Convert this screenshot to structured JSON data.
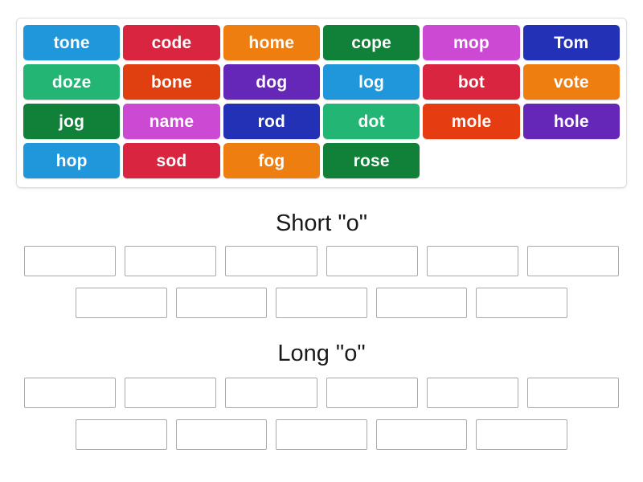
{
  "word_bank": {
    "tiles": [
      {
        "label": "tone",
        "color": "#1f97da"
      },
      {
        "label": "code",
        "color": "#d9253f"
      },
      {
        "label": "home",
        "color": "#ef7e10"
      },
      {
        "label": "cope",
        "color": "#118039"
      },
      {
        "label": "mop",
        "color": "#cc49d4"
      },
      {
        "label": "Tom",
        "color": "#2231b5"
      },
      {
        "label": "doze",
        "color": "#22b573"
      },
      {
        "label": "bone",
        "color": "#e0400f"
      },
      {
        "label": "dog",
        "color": "#6527b8"
      },
      {
        "label": "log",
        "color": "#1f97da"
      },
      {
        "label": "bot",
        "color": "#d9253f"
      },
      {
        "label": "vote",
        "color": "#ef7e10"
      },
      {
        "label": "jog",
        "color": "#118039"
      },
      {
        "label": "name",
        "color": "#cc49d4"
      },
      {
        "label": "rod",
        "color": "#2231b5"
      },
      {
        "label": "dot",
        "color": "#22b573"
      },
      {
        "label": "mole",
        "color": "#e63c12"
      },
      {
        "label": "hole",
        "color": "#6527b8"
      },
      {
        "label": "hop",
        "color": "#1f97da"
      },
      {
        "label": "sod",
        "color": "#d9253f"
      },
      {
        "label": "fog",
        "color": "#ef7e10"
      },
      {
        "label": "rose",
        "color": "#118039"
      }
    ]
  },
  "sections": [
    {
      "title": "Short \"o\"",
      "rows": [
        {
          "slots": [
            "",
            "",
            "",
            "",
            "",
            ""
          ]
        },
        {
          "slots": [
            "",
            "",
            "",
            "",
            ""
          ]
        }
      ]
    },
    {
      "title": "Long \"o\"",
      "rows": [
        {
          "slots": [
            "",
            "",
            "",
            "",
            "",
            ""
          ]
        },
        {
          "slots": [
            "",
            "",
            "",
            "",
            ""
          ]
        }
      ]
    }
  ],
  "colors": {
    "card_border": "#dddddd",
    "zone_border": "#a9a9a9",
    "page_background": "#ffffff",
    "tile_text": "#ffffff",
    "heading_text": "#1a1a1a"
  }
}
